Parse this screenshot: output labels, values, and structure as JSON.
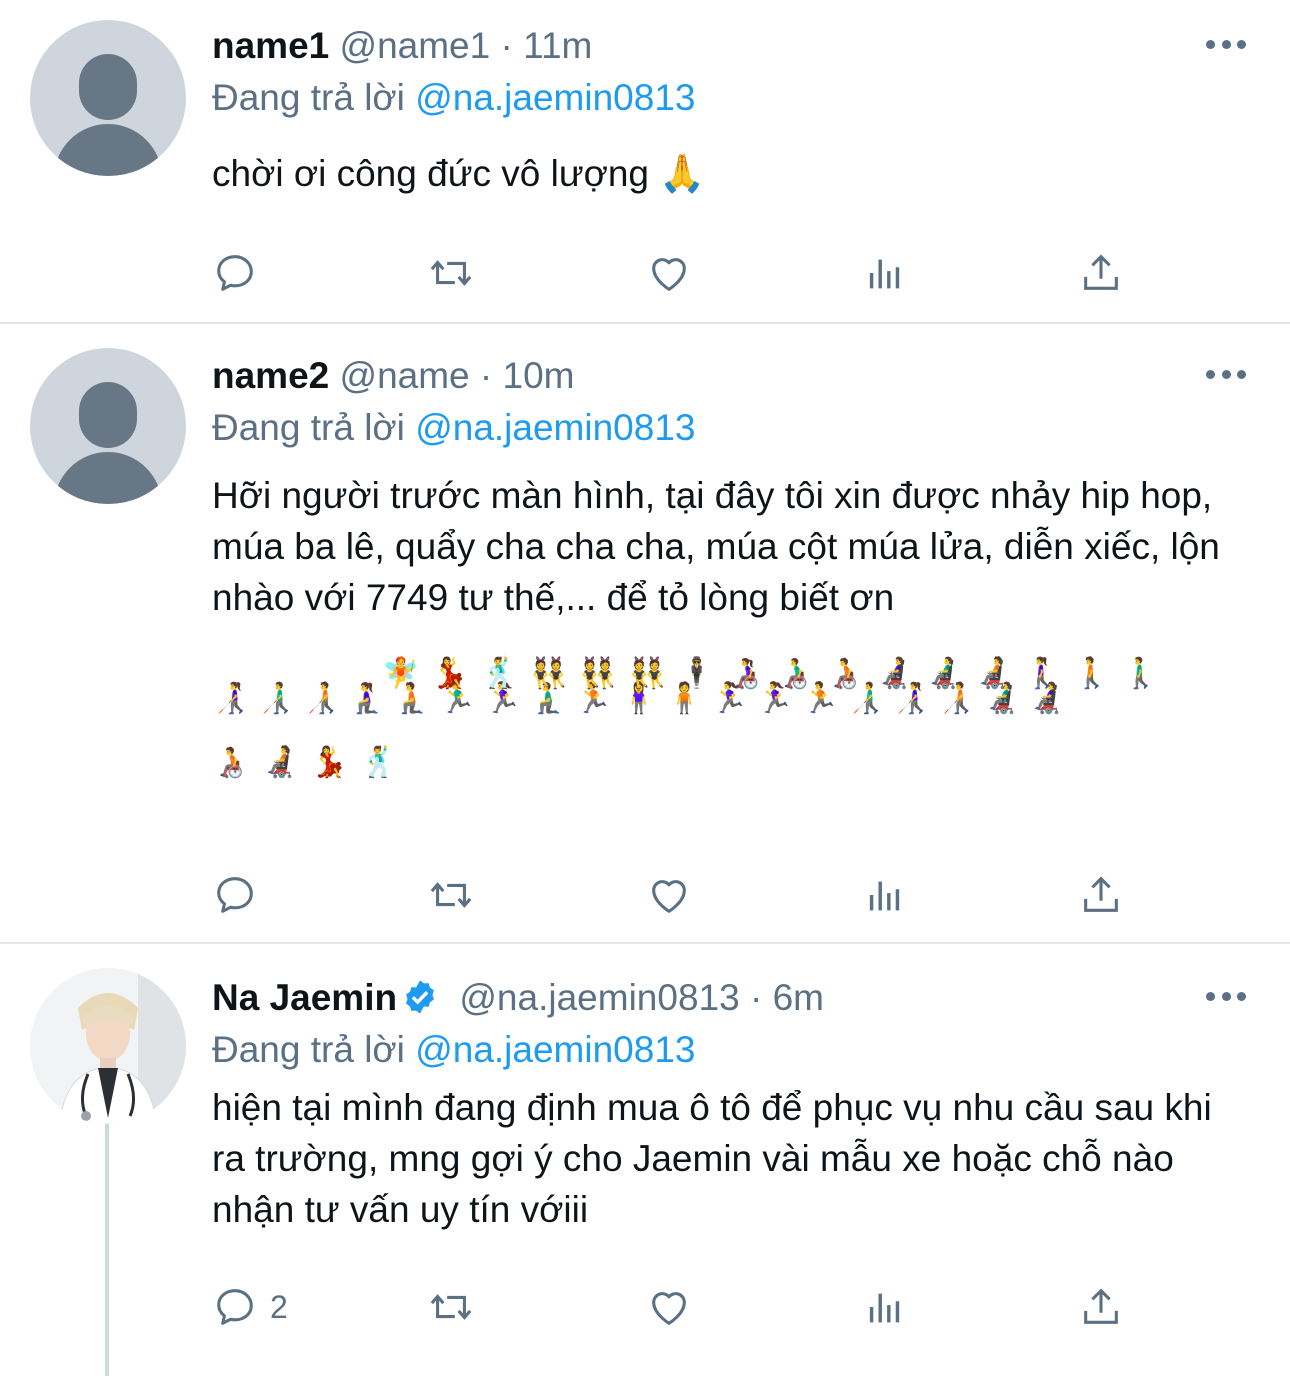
{
  "tweets": [
    {
      "name": "name1",
      "handle": "@name1",
      "time": "11m",
      "reply_prefix": "Đang trả lời",
      "reply_to": "@na.jaemin0813",
      "text": "chời ơi công đức vô lượng 🙏",
      "reply_count": ""
    },
    {
      "name": "name2",
      "handle": "@name",
      "time": "10m",
      "reply_prefix": "Đang trả lời",
      "reply_to": "@na.jaemin0813",
      "text": "Hỡi người trước màn hình, tại đây tôi xin được nhảy hip hop, múa ba lê, quẩy cha cha cha, múa cột múa lửa, diễn xiếc, lộn nhào với 7749 tư thế,... để tỏ lòng biết ơn",
      "emoji_line_1": "🧚💃🕺👯👯👯🕴👩‍🦽👨‍🦽🧑‍🦽👩‍🦼👨‍🦼🧑‍🦼🚶‍♀️🚶🚶‍♂️",
      "emoji_line_2": "👩‍🦯👨‍🦯🧑‍🦯🧎‍♀️🧎🏃‍♂️🏃‍♀️🧎‍♂️🏃🧍‍♀️🧍🏃‍♀️🏃‍♀️🏃👨‍🦯👩‍🦯🧑‍🦯👨‍🦼👩‍🦼",
      "emoji_line_3": "🧑‍🦽🧑‍🦼💃🕺",
      "reply_count": ""
    },
    {
      "name": "Na Jaemin",
      "handle": "@na.jaemin0813",
      "time": "6m",
      "reply_prefix": "Đang trả lời",
      "reply_to": "@na.jaemin0813",
      "text": "hiện tại mình đang định mua ô tô để phục vụ nhu cầu sau khi ra trường, mng gợi ý cho Jaemin vài mẫu xe hoặc chỗ nào nhận tư vấn uy tín vớiii",
      "reply_count": "2"
    }
  ],
  "separator": " · ",
  "colors": {
    "mention": "#1d9bf0",
    "meta": "#5b7083",
    "verified": "#1d9bf0",
    "divider": "#e3e6e9"
  },
  "icons": [
    "reply-icon",
    "retweet-icon",
    "like-icon",
    "analytics-icon",
    "share-icon",
    "more-icon",
    "verified-badge-icon"
  ]
}
